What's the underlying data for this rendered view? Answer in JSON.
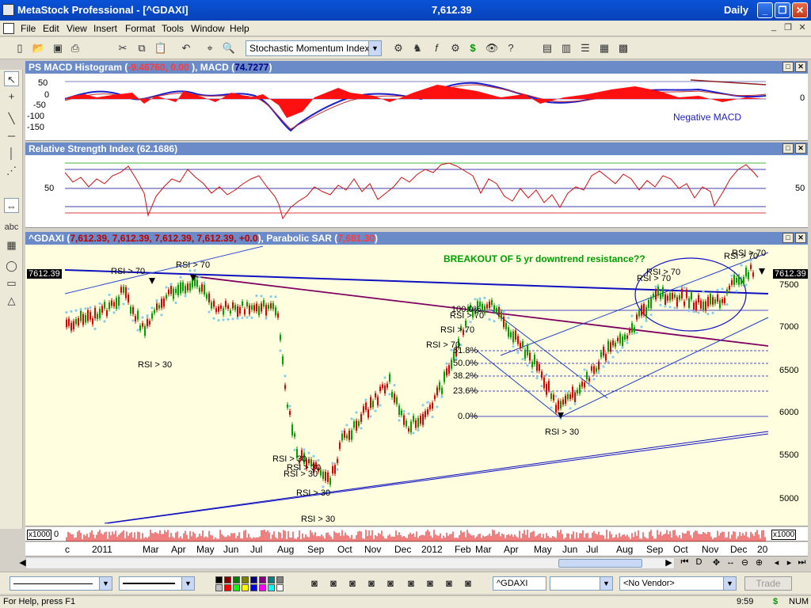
{
  "window": {
    "title": "MetaStock Professional - [^GDAXI]",
    "price": "7,612.39",
    "period": "Daily",
    "min": "_",
    "restore": "❐",
    "close": "✕"
  },
  "menu": {
    "items": [
      "File",
      "Edit",
      "View",
      "Insert",
      "Format",
      "Tools",
      "Window",
      "Help"
    ]
  },
  "toolbar": {
    "indicator": "Stochastic Momentum Index"
  },
  "macd_panel": {
    "title_prefix": "PS MACD Histogram (",
    "hist_value": "-9.46760, 0.00",
    "title_mid": " ), MACD (",
    "macd_value": "74.7277",
    "title_suffix": ")",
    "annotation": "Negative MACD",
    "y_ticks": [
      "50",
      "0",
      "-50",
      "-100",
      "-150"
    ],
    "right_tick": "0"
  },
  "rsi_panel": {
    "title": "Relative Strength Index (62.1686)",
    "y_left": "50",
    "y_right": "50"
  },
  "price_panel": {
    "title_prefix": "^GDAXI (",
    "values": "7,612.39, 7,612.39, 7,612.39, 7,612.39, +0.0",
    "title_mid": "), Parabolic SAR (",
    "sar_value": "7,681.30",
    "title_suffix": ")",
    "headline": "BREAKOUT OF 5 yr downtrend resistance??",
    "last_price_tag": "7612.39",
    "y_ticks": [
      "7500",
      "7000",
      "6500",
      "6000",
      "5500",
      "5000"
    ],
    "fib_labels": [
      "100.0%",
      "61.8%",
      "50.0%",
      "38.2%",
      "23.6%",
      "0.0%"
    ],
    "rsi_notes": [
      "RSI > 70",
      "RSI > 70",
      "RSI > 30",
      "RSI > 30",
      "RSI > 30",
      "RSI > 30",
      "RSI > 30",
      "RSI > 30",
      "RSI > 70",
      "RSI > 70",
      "RSI > 70",
      "RSI > 30",
      "RSI > 70",
      "RSI > 70",
      "RSI > 70",
      "RSI > 70"
    ]
  },
  "volume": {
    "scale_left": "x1000",
    "zero": "0",
    "scale_right": "x1000"
  },
  "x_axis": {
    "labels": [
      "c",
      "2011",
      "Mar",
      "Apr",
      "May",
      "Jun",
      "Jul",
      "Aug",
      "Sep",
      "Oct",
      "Nov",
      "Dec",
      "2012",
      "Feb",
      "Mar",
      "Apr",
      "May",
      "Jun",
      "Jul",
      "Aug",
      "Sep",
      "Oct",
      "Nov",
      "Dec",
      "20"
    ]
  },
  "bottom": {
    "symbol": "^GDAXI",
    "vendor": "<No Vendor>",
    "trade": "Trade"
  },
  "status": {
    "help": "For Help, press F1",
    "time": "9:59",
    "dollar": "$",
    "num": "NUM"
  },
  "colors": {
    "title_blue": "#0a52d8",
    "panel_head": "#6a8ac8",
    "candle_up": "#00a000",
    "candle_down": "#e00000",
    "sar": "#87ceeb",
    "chart_bg": "#ffffe0"
  }
}
